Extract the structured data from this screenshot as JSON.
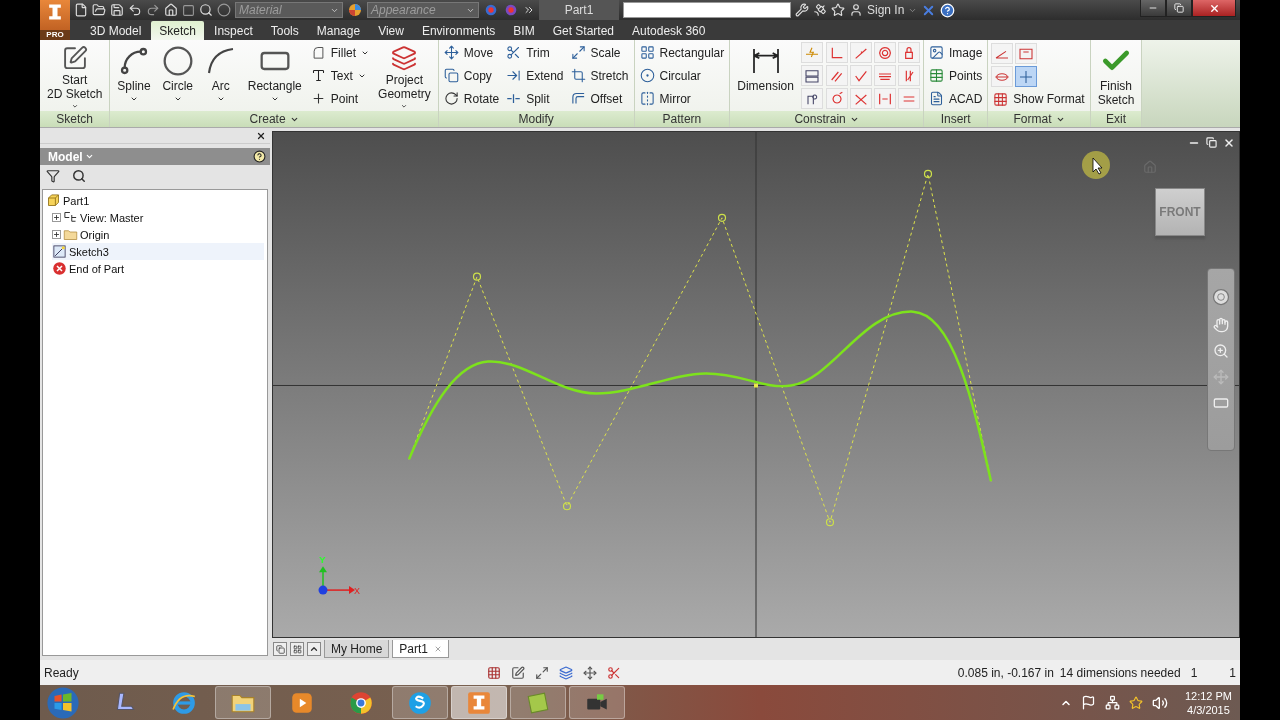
{
  "app": {
    "edition": "PRO"
  },
  "quick_access": {
    "material": "Material",
    "appearance": "Appearance",
    "document": "Part1",
    "sign_in": "Sign In"
  },
  "ribbon_tabs": [
    {
      "label": "3D Model",
      "selected": false
    },
    {
      "label": "Sketch",
      "selected": true
    },
    {
      "label": "Inspect",
      "selected": false
    },
    {
      "label": "Tools",
      "selected": false
    },
    {
      "label": "Manage",
      "selected": false
    },
    {
      "label": "View",
      "selected": false
    },
    {
      "label": "Environments",
      "selected": false
    },
    {
      "label": "BIM",
      "selected": false
    },
    {
      "label": "Get Started",
      "selected": false
    },
    {
      "label": "Autodesk 360",
      "selected": false
    }
  ],
  "ribbon_panels": [
    {
      "title": "Sketch",
      "menu": false,
      "groups": [
        {
          "kind": "large",
          "button": {
            "kind": "start-sketch",
            "label": [
              "Start",
              "2D Sketch"
            ],
            "dropdown": true
          }
        }
      ]
    },
    {
      "title": "Create",
      "menu": true,
      "groups": [
        {
          "kind": "large",
          "button": {
            "kind": "spline",
            "label": [
              "Spline"
            ],
            "dropdown": true
          }
        },
        {
          "kind": "large",
          "button": {
            "kind": "circle",
            "label": [
              "Circle"
            ],
            "dropdown": true
          }
        },
        {
          "kind": "large",
          "button": {
            "kind": "arc",
            "label": [
              "Arc"
            ],
            "dropdown": true
          }
        },
        {
          "kind": "large",
          "button": {
            "kind": "rectangle",
            "label": [
              "Rectangle"
            ],
            "dropdown": true
          }
        },
        {
          "kind": "column",
          "tools": [
            {
              "kind": "fillet",
              "label": "Fillet",
              "dropdown": true
            },
            {
              "kind": "text",
              "label": "Text",
              "dropdown": true
            },
            {
              "kind": "point",
              "label": "Point",
              "dropdown": false
            }
          ]
        },
        {
          "kind": "large",
          "button": {
            "kind": "project",
            "label": [
              "Project",
              "Geometry"
            ],
            "dropdown": true
          }
        }
      ]
    },
    {
      "title": "Modify",
      "menu": false,
      "groups": [
        {
          "kind": "column",
          "tools": [
            {
              "kind": "move",
              "label": "Move",
              "dropdown": false
            },
            {
              "kind": "copy",
              "label": "Copy",
              "dropdown": false
            },
            {
              "kind": "rotate",
              "label": "Rotate",
              "dropdown": false
            }
          ]
        },
        {
          "kind": "column",
          "tools": [
            {
              "kind": "trim",
              "label": "Trim",
              "dropdown": false
            },
            {
              "kind": "extend",
              "label": "Extend",
              "dropdown": false
            },
            {
              "kind": "split",
              "label": "Split",
              "dropdown": false
            }
          ]
        },
        {
          "kind": "column",
          "tools": [
            {
              "kind": "scale",
              "label": "Scale",
              "dropdown": false
            },
            {
              "kind": "stretch",
              "label": "Stretch",
              "dropdown": false
            },
            {
              "kind": "offset",
              "label": "Offset",
              "dropdown": false
            }
          ]
        }
      ]
    },
    {
      "title": "Pattern",
      "menu": false,
      "groups": [
        {
          "kind": "column",
          "tools": [
            {
              "kind": "rectangular",
              "label": "Rectangular",
              "dropdown": false
            },
            {
              "kind": "circular",
              "label": "Circular",
              "dropdown": false
            },
            {
              "kind": "mirror",
              "label": "Mirror",
              "dropdown": false
            }
          ]
        }
      ]
    },
    {
      "title": "Constrain",
      "menu": true,
      "groups": [
        {
          "kind": "large",
          "button": {
            "kind": "dimension",
            "label": [
              "Dimension"
            ],
            "dropdown": false
          }
        },
        {
          "kind": "dimension-icons"
        },
        {
          "kind": "constraint-icons"
        }
      ]
    },
    {
      "title": "Insert",
      "menu": false,
      "groups": [
        {
          "kind": "column",
          "tools": [
            {
              "kind": "image",
              "label": "Image",
              "dropdown": false
            },
            {
              "kind": "points",
              "label": "Points",
              "dropdown": false
            },
            {
              "kind": "acad",
              "label": "ACAD",
              "dropdown": false
            }
          ]
        }
      ]
    },
    {
      "title": "Format",
      "menu": true,
      "groups": [
        {
          "kind": "format-tools",
          "toggles": [
            {
              "on": false
            },
            {
              "on": false
            },
            {
              "on": false
            },
            {
              "on": true
            }
          ],
          "tools": [
            {
              "kind": "show-format",
              "label": "Show Format",
              "dropdown": false
            }
          ]
        }
      ]
    },
    {
      "title": "Exit",
      "menu": false,
      "groups": [
        {
          "kind": "large",
          "button": {
            "kind": "finish",
            "label": [
              "Finish",
              "Sketch"
            ],
            "dropdown": false
          }
        }
      ]
    }
  ],
  "browser": {
    "title": "Model",
    "tree": [
      {
        "label": "Part1",
        "kind": "part",
        "selected": false,
        "children": [
          {
            "label": "View: Master",
            "kind": "view",
            "expanded": false,
            "selected": false
          },
          {
            "label": "Origin",
            "kind": "folder",
            "expanded": false,
            "selected": false
          },
          {
            "label": "Sketch3",
            "kind": "sketch",
            "selected": true
          },
          {
            "label": "End of Part",
            "kind": "end",
            "selected": false
          }
        ]
      }
    ]
  },
  "viewport": {
    "view_cube": "FRONT",
    "axis_x": "X",
    "axis_y": "Y"
  },
  "document_tabs": [
    {
      "label": "My Home",
      "selected": false
    },
    {
      "label": "Part1",
      "selected": true
    }
  ],
  "status_bar": {
    "message": "Ready",
    "coordinates": "0.085 in, -0.167 in",
    "dimensions": "14 dimensions needed",
    "count_1": "1",
    "count_2": "1"
  },
  "taskbar": {
    "apps": [
      {
        "kind": "scanner",
        "running": false,
        "selected": false
      },
      {
        "kind": "browser-e",
        "running": false,
        "selected": false
      },
      {
        "kind": "folder",
        "running": true,
        "selected": false
      },
      {
        "kind": "media",
        "running": false,
        "selected": false
      },
      {
        "kind": "chrome",
        "running": false,
        "selected": false
      },
      {
        "kind": "chat",
        "running": true,
        "selected": false
      },
      {
        "kind": "inventor",
        "running": true,
        "selected": true
      },
      {
        "kind": "notes",
        "running": true,
        "selected": false
      },
      {
        "kind": "camera",
        "running": true,
        "selected": false
      }
    ],
    "time": "12:12 PM",
    "date": "4/3/2015"
  }
}
